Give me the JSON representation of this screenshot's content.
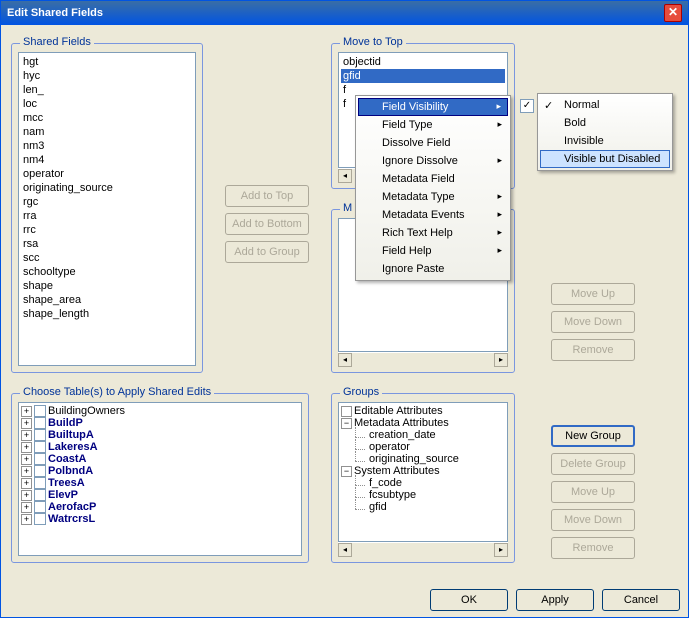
{
  "window": {
    "title": "Edit Shared Fields"
  },
  "shared_fields": {
    "legend": "Shared Fields",
    "items": [
      "hgt",
      "hyc",
      "len_",
      "loc",
      "mcc",
      "nam",
      "nm3",
      "nm4",
      "operator",
      "originating_source",
      "rgc",
      "rra",
      "rrc",
      "rsa",
      "scc",
      "schooltype",
      "shape",
      "shape_area",
      "shape_length"
    ]
  },
  "mid_buttons": {
    "add_to_top": "Add to Top",
    "add_to_bottom": "Add to Bottom",
    "add_to_group": "Add to Group"
  },
  "move_top": {
    "legend": "Move to Top",
    "items": [
      "objectid",
      "gfid",
      "f",
      "f"
    ]
  },
  "ctx_menu": {
    "items": [
      {
        "label": "Field Visibility",
        "sub": true,
        "hl": true
      },
      {
        "label": "Field Type",
        "sub": true
      },
      {
        "label": "Dissolve Field"
      },
      {
        "label": "Ignore Dissolve",
        "sub": true
      },
      {
        "label": "Metadata Field"
      },
      {
        "label": "Metadata Type",
        "sub": true
      },
      {
        "label": "Metadata Events",
        "sub": true
      },
      {
        "label": "Rich Text Help",
        "sub": true
      },
      {
        "label": "Field Help",
        "sub": true
      },
      {
        "label": "Ignore Paste"
      }
    ],
    "sub_items": [
      {
        "label": "Normal",
        "checked": true
      },
      {
        "label": "Bold"
      },
      {
        "label": "Invisible"
      },
      {
        "label": "Visible but Disabled",
        "hl": true
      }
    ]
  },
  "right_buttons_top": {
    "move_up": "Move Up",
    "move_down": "Move Down",
    "remove": "Remove"
  },
  "choose_tables": {
    "legend": "Choose Table(s) to Apply Shared Edits",
    "items": [
      {
        "label": "BuildingOwners",
        "bold": false
      },
      {
        "label": "BuildP",
        "bold": true
      },
      {
        "label": "BuiltupA",
        "bold": true
      },
      {
        "label": "LakeresA",
        "bold": true
      },
      {
        "label": "CoastA",
        "bold": true
      },
      {
        "label": "PolbndA",
        "bold": true
      },
      {
        "label": "TreesA",
        "bold": true
      },
      {
        "label": "ElevP",
        "bold": true
      },
      {
        "label": "AerofacP",
        "bold": true
      },
      {
        "label": "WatrcrsL",
        "bold": true
      }
    ]
  },
  "groups": {
    "legend": "Groups",
    "root1": {
      "label": "Editable Attributes"
    },
    "root2": {
      "label": "Metadata Attributes",
      "children": [
        "creation_date",
        "operator",
        "originating_source"
      ]
    },
    "root3": {
      "label": "System Attributes",
      "children": [
        "f_code",
        "fcsubtype",
        "gfid"
      ]
    }
  },
  "right_buttons_groups": {
    "new_group": "New Group",
    "delete_group": "Delete Group",
    "move_up": "Move Up",
    "move_down": "Move Down",
    "remove": "Remove"
  },
  "bottom": {
    "ok": "OK",
    "apply": "Apply",
    "cancel": "Cancel"
  }
}
